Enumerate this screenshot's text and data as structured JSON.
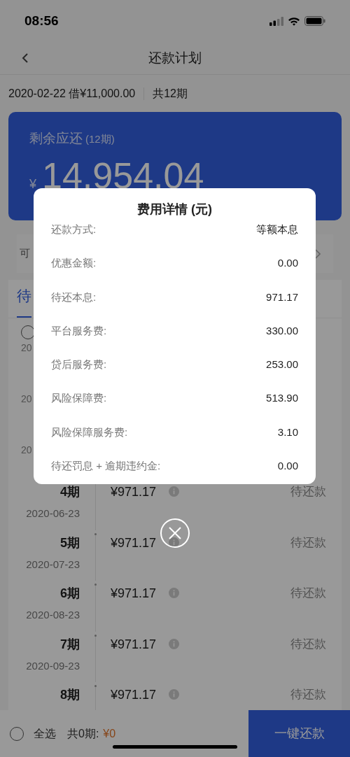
{
  "status_bar": {
    "time": "08:56"
  },
  "nav": {
    "title": "还款计划"
  },
  "loan_summary": {
    "date_amount": "2020-02-22 借¥11,000.00",
    "periods": "共12期"
  },
  "balance_card": {
    "label": "剩余应还",
    "label_suffix": "(12期)",
    "currency": "¥",
    "amount": "14,954.04"
  },
  "filter_row": {
    "text": "可"
  },
  "tabs": [
    {
      "label": "待",
      "selected": true
    }
  ],
  "hidden_rows": [
    {
      "checked": false,
      "date": "20"
    },
    {
      "date": "20"
    },
    {
      "date": "20"
    }
  ],
  "installments": [
    {
      "period": "4期",
      "date": "2020-06-23",
      "amount": "¥971.17",
      "status": "待还款"
    },
    {
      "period": "5期",
      "date": "2020-07-23",
      "amount": "¥971.17",
      "status": "待还款"
    },
    {
      "period": "6期",
      "date": "2020-08-23",
      "amount": "¥971.17",
      "status": "待还款"
    },
    {
      "period": "7期",
      "date": "2020-09-23",
      "amount": "¥971.17",
      "status": "待还款"
    },
    {
      "period": "8期",
      "amount": "¥971.17",
      "status": "待还款"
    }
  ],
  "footer": {
    "select_all": {
      "label": "全选",
      "checked": false
    },
    "count": "共0期:",
    "total": "¥0",
    "button": "一键还款"
  },
  "modal": {
    "title": "费用详情 (元)",
    "rows": [
      {
        "label": "还款方式:",
        "value": "等额本息"
      },
      {
        "label": "优惠金额:",
        "value": "0.00"
      },
      {
        "label": "待还本息:",
        "value": "971.17"
      },
      {
        "label": "平台服务费:",
        "value": "330.00"
      },
      {
        "label": "贷后服务费:",
        "value": "253.00"
      },
      {
        "label": "风险保障费:",
        "value": "513.90"
      },
      {
        "label": "风险保障服务费:",
        "value": "3.10"
      },
      {
        "label": "待还罚息 + 逾期违约金:",
        "value": "0.00"
      }
    ]
  }
}
